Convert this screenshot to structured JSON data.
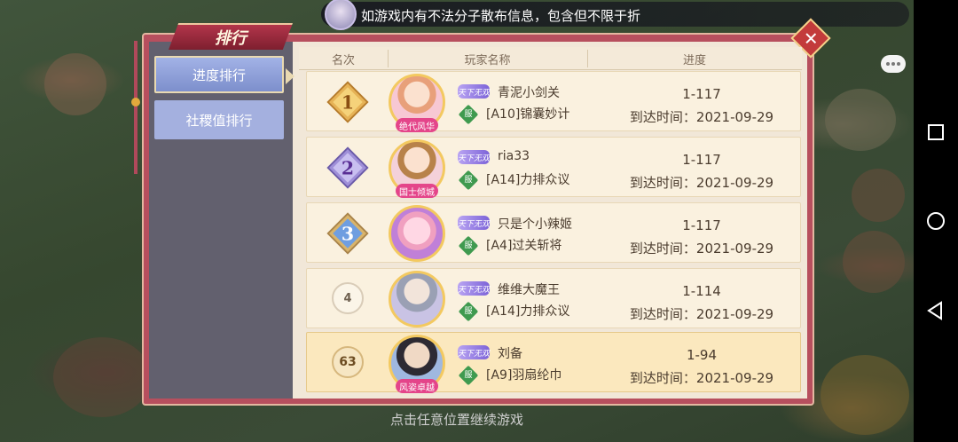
{
  "ticker": {
    "text": "如游戏内有不法分子散布信息，包含但不限于折"
  },
  "panel": {
    "title": "排行",
    "close_label": "✕"
  },
  "tabs": [
    {
      "label": "进度排行",
      "active": true
    },
    {
      "label": "社稷值排行",
      "active": false
    }
  ],
  "table": {
    "headers": [
      "名次",
      "玩家名称",
      "进度"
    ],
    "rows": [
      {
        "rank": "1",
        "badge": "gold",
        "avatar_title": "绝代风华",
        "level_tag": "天下无双",
        "name": "青泥小剑关",
        "server": "[A10]锦囊妙计",
        "stage": "1-117",
        "reach": "到达时间：2021-09-29"
      },
      {
        "rank": "2",
        "badge": "purple",
        "avatar_title": "国士倾城",
        "level_tag": "天下无双",
        "name": "ria33",
        "server": "[A14]力排众议",
        "stage": "1-117",
        "reach": "到达时间：2021-09-29"
      },
      {
        "rank": "3",
        "badge": "blue",
        "avatar_title": "",
        "level_tag": "天下无双",
        "name": "只是个小辣姬",
        "server": "[A4]过关斩将",
        "stage": "1-117",
        "reach": "到达时间：2021-09-29"
      },
      {
        "rank": "4",
        "badge": "plain",
        "avatar_title": "",
        "level_tag": "天下无双",
        "name": "维维大魔王",
        "server": "[A14]力排众议",
        "stage": "1-114",
        "reach": "到达时间：2021-09-29"
      },
      {
        "rank": "63",
        "badge": "self",
        "avatar_title": "风姿卓越",
        "level_tag": "天下无双",
        "name": "刘备",
        "server": "[A9]羽扇纶巾",
        "stage": "1-94",
        "reach": "到达时间：2021-09-29"
      }
    ]
  },
  "hint": "点击任意位置继续游戏",
  "server_icon_label": "服",
  "colors": {
    "panel_border": "#b74f5e",
    "row_bg": "#faf1df",
    "highlight_bg": "#fbe8be",
    "tab_active": "#8d9fd9"
  }
}
